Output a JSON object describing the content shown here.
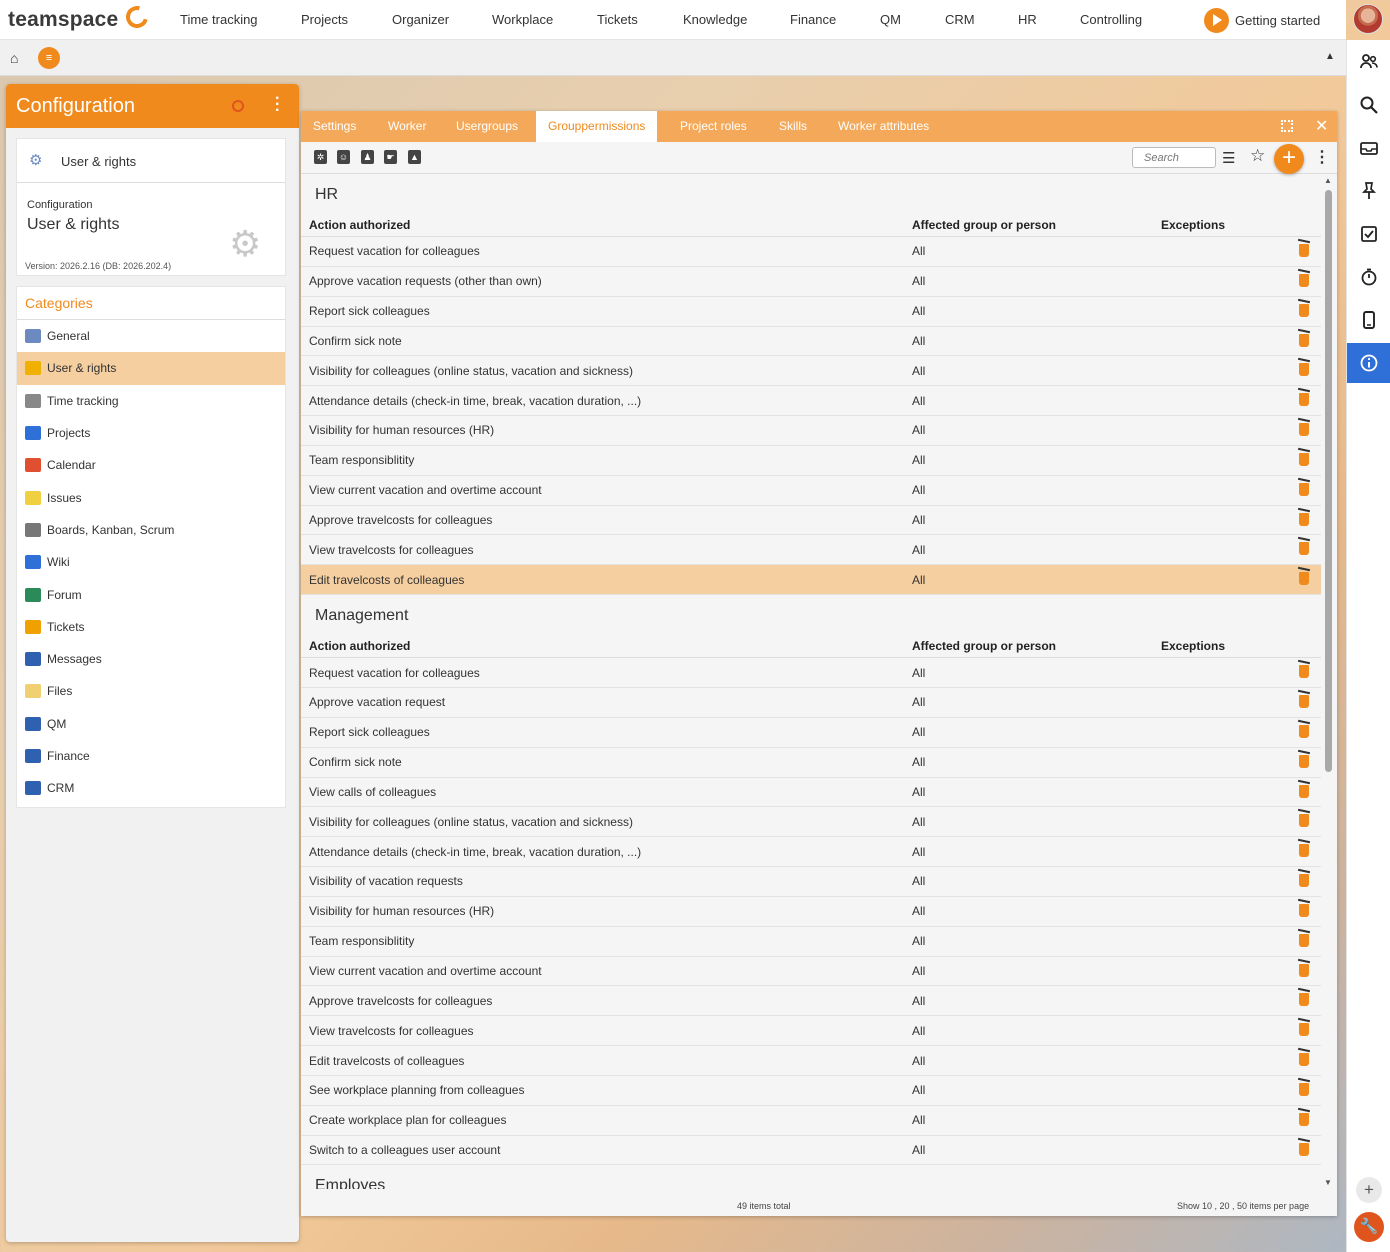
{
  "topnav": {
    "logo": "teamspace",
    "items": [
      "Time tracking",
      "Projects",
      "Organizer",
      "Workplace",
      "Tickets",
      "Knowledge",
      "Finance",
      "QM",
      "CRM",
      "HR",
      "Controlling"
    ],
    "getting_started": "Getting started"
  },
  "sidebar": {
    "title": "Configuration",
    "card_row_label": "User & rights",
    "card_category": "Configuration",
    "card_name": "User & rights",
    "version": "Version: 2026.2.16 (DB: 2026.202.4)",
    "categories_title": "Categories",
    "categories": [
      {
        "label": "General",
        "icon": "gear-icon",
        "color": "#6a8ac0"
      },
      {
        "label": "User & rights",
        "icon": "users-icon",
        "color": "#f0b000",
        "active": true
      },
      {
        "label": "Time tracking",
        "icon": "stopwatch-icon",
        "color": "#888888"
      },
      {
        "label": "Projects",
        "icon": "folder-icon",
        "color": "#2f6fd8"
      },
      {
        "label": "Calendar",
        "icon": "calendar-icon",
        "color": "#e05030"
      },
      {
        "label": "Issues",
        "icon": "sticky-note-icon",
        "color": "#f0d040"
      },
      {
        "label": "Boards, Kanban, Scrum",
        "icon": "kanban-icon",
        "color": "#777777"
      },
      {
        "label": "Wiki",
        "icon": "wiki-icon",
        "color": "#2f6fd8"
      },
      {
        "label": "Forum",
        "icon": "globe-icon",
        "color": "#2a8a5a"
      },
      {
        "label": "Tickets",
        "icon": "ticket-icon",
        "color": "#f0a000"
      },
      {
        "label": "Messages",
        "icon": "messages-icon",
        "color": "#3060b0"
      },
      {
        "label": "Files",
        "icon": "files-icon",
        "color": "#f0d070"
      },
      {
        "label": "QM",
        "icon": "qm-icon",
        "color": "#3060b0"
      },
      {
        "label": "Finance",
        "icon": "euro-icon",
        "color": "#3060b0"
      },
      {
        "label": "CRM",
        "icon": "contact-card-icon",
        "color": "#3060b0"
      }
    ]
  },
  "tabs": [
    "Settings",
    "Worker",
    "Usergroups",
    "Grouppermissions",
    "Project roles",
    "Skills",
    "Worker attributes"
  ],
  "active_tab": "Grouppermissions",
  "toolbar": {
    "search_placeholder": "Search"
  },
  "columns": {
    "action": "Action authorized",
    "group": "Affected group or person",
    "exceptions": "Exceptions"
  },
  "groups": [
    {
      "title": "HR",
      "rows": [
        {
          "action": "Request vacation for colleagues",
          "group": "All",
          "exceptions": ""
        },
        {
          "action": "Approve vacation requests (other than own)",
          "group": "All",
          "exceptions": ""
        },
        {
          "action": "Report sick colleagues",
          "group": "All",
          "exceptions": ""
        },
        {
          "action": "Confirm sick note",
          "group": "All",
          "exceptions": ""
        },
        {
          "action": "Visibility for colleagues (online status, vacation and sickness)",
          "group": "All",
          "exceptions": ""
        },
        {
          "action": "Attendance details (check-in time, break, vacation duration, ...)",
          "group": "All",
          "exceptions": ""
        },
        {
          "action": "Visibility for human resources (HR)",
          "group": "All",
          "exceptions": ""
        },
        {
          "action": "Team responsiblitity",
          "group": "All",
          "exceptions": ""
        },
        {
          "action": "View current vacation and overtime account",
          "group": "All",
          "exceptions": ""
        },
        {
          "action": "Approve travelcosts for colleagues",
          "group": "All",
          "exceptions": ""
        },
        {
          "action": "View travelcosts for colleagues",
          "group": "All",
          "exceptions": ""
        },
        {
          "action": "Edit travelcosts of colleagues",
          "group": "All",
          "exceptions": "",
          "selected": true
        }
      ]
    },
    {
      "title": "Management",
      "rows": [
        {
          "action": "Request vacation for colleagues",
          "group": "All",
          "exceptions": ""
        },
        {
          "action": "Approve vacation request",
          "group": "All",
          "exceptions": ""
        },
        {
          "action": "Report sick colleagues",
          "group": "All",
          "exceptions": ""
        },
        {
          "action": "Confirm sick note",
          "group": "All",
          "exceptions": ""
        },
        {
          "action": "View calls of colleagues",
          "group": "All",
          "exceptions": ""
        },
        {
          "action": "Visibility for colleagues (online status, vacation and sickness)",
          "group": "All",
          "exceptions": ""
        },
        {
          "action": "Attendance details (check-in time, break, vacation duration, ...)",
          "group": "All",
          "exceptions": ""
        },
        {
          "action": "Visibility of vacation requests",
          "group": "All",
          "exceptions": ""
        },
        {
          "action": "Visibility for human resources (HR)",
          "group": "All",
          "exceptions": ""
        },
        {
          "action": "Team responsiblitity",
          "group": "All",
          "exceptions": ""
        },
        {
          "action": "View current vacation and overtime account",
          "group": "All",
          "exceptions": ""
        },
        {
          "action": "Approve travelcosts for colleagues",
          "group": "All",
          "exceptions": ""
        },
        {
          "action": "View travelcosts for colleagues",
          "group": "All",
          "exceptions": ""
        },
        {
          "action": "Edit travelcosts of colleagues",
          "group": "All",
          "exceptions": ""
        },
        {
          "action": "See workplace planning from colleagues",
          "group": "All",
          "exceptions": ""
        },
        {
          "action": "Create workplace plan for colleagues",
          "group": "All",
          "exceptions": ""
        },
        {
          "action": "Switch to a colleagues user account",
          "group": "All",
          "exceptions": ""
        }
      ]
    },
    {
      "title": "Employes",
      "rows": []
    }
  ],
  "footer": {
    "items_total": "49 items total",
    "paging": "Show  10 ,  20 ,  50  items per page"
  },
  "colors": {
    "accent": "#f08a1c",
    "tab_bar": "#f4a95a",
    "selected_row": "#f5cfa0",
    "info_blue": "#2f6fd8"
  }
}
